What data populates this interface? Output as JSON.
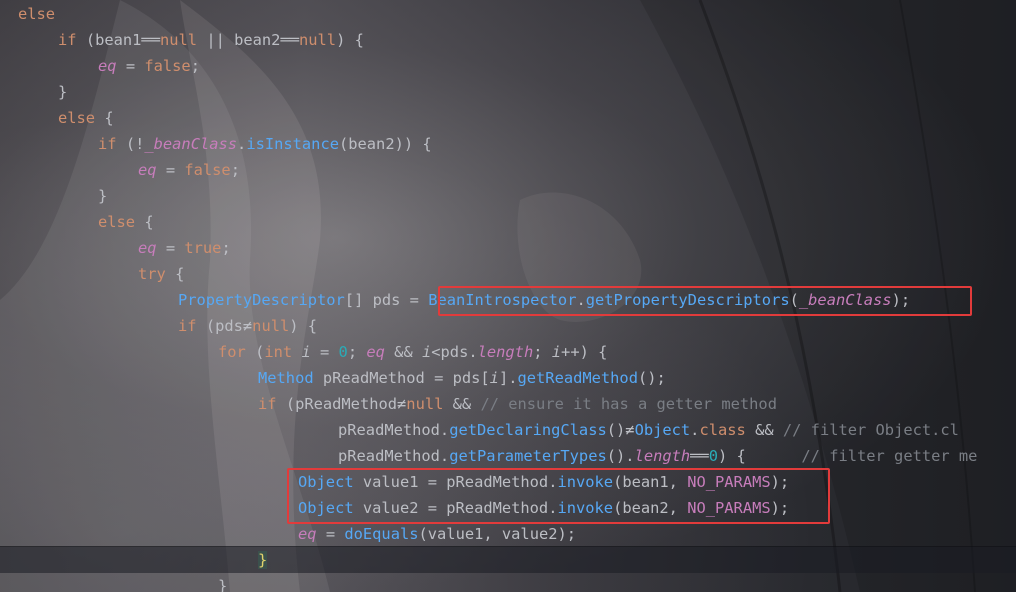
{
  "editor": {
    "language": "java",
    "colors": {
      "keyword": "#cf8e6d",
      "field_italic": "#c77dbb",
      "method": "#56a8f5",
      "number": "#2aacb8",
      "comment": "#7a7e85",
      "text": "#bcbec4",
      "highlight_box": "#e23b3b"
    },
    "lines": [
      {
        "id": "l1",
        "indent": 0,
        "tokens": [
          [
            "kw",
            "else"
          ]
        ]
      },
      {
        "id": "l2",
        "indent": 1,
        "tokens": [
          [
            "kw",
            "if "
          ],
          [
            "",
            "(bean1"
          ],
          [
            "",
            "══"
          ],
          [
            "kw",
            "null"
          ],
          [
            "",
            " || bean2"
          ],
          [
            "",
            "══"
          ],
          [
            "kw",
            "null"
          ],
          [
            "",
            ") {"
          ]
        ]
      },
      {
        "id": "l3",
        "indent": 2,
        "tokens": [
          [
            "fld",
            "eq"
          ],
          [
            "",
            " = "
          ],
          [
            "kw",
            "false"
          ],
          [
            "",
            ";"
          ]
        ]
      },
      {
        "id": "l4",
        "indent": 1,
        "tokens": [
          [
            "",
            "}"
          ]
        ]
      },
      {
        "id": "l5",
        "indent": 1,
        "tokens": [
          [
            "kw",
            "else "
          ],
          [
            "",
            "{"
          ]
        ]
      },
      {
        "id": "l6",
        "indent": 2,
        "tokens": [
          [
            "kw",
            "if "
          ],
          [
            "",
            "(!"
          ],
          [
            "fld",
            "_beanClass"
          ],
          [
            "",
            "."
          ],
          [
            "mth",
            "isInstance"
          ],
          [
            "",
            "(bean2)) {"
          ]
        ]
      },
      {
        "id": "l7",
        "indent": 3,
        "tokens": [
          [
            "fld",
            "eq"
          ],
          [
            "",
            " = "
          ],
          [
            "kw",
            "false"
          ],
          [
            "",
            ";"
          ]
        ]
      },
      {
        "id": "l8",
        "indent": 2,
        "tokens": [
          [
            "",
            "}"
          ]
        ]
      },
      {
        "id": "l9",
        "indent": 2,
        "tokens": [
          [
            "kw",
            "else "
          ],
          [
            "",
            "{"
          ]
        ]
      },
      {
        "id": "l10",
        "indent": 3,
        "tokens": [
          [
            "fld",
            "eq"
          ],
          [
            "",
            " = "
          ],
          [
            "kw",
            "true"
          ],
          [
            "",
            ";"
          ]
        ]
      },
      {
        "id": "l11",
        "indent": 3,
        "tokens": [
          [
            "kw",
            "try "
          ],
          [
            "",
            "{"
          ]
        ]
      },
      {
        "id": "l12",
        "indent": 4,
        "tokens": [
          [
            "cls",
            "PropertyDescriptor"
          ],
          [
            "",
            "[] pds = "
          ],
          [
            "cls",
            "BeanIntrospector"
          ],
          [
            "",
            "."
          ],
          [
            "mth",
            "getPropertyDescriptors"
          ],
          [
            "",
            "("
          ],
          [
            "fld",
            "_beanClass"
          ],
          [
            "",
            ");"
          ]
        ]
      },
      {
        "id": "l13",
        "indent": 4,
        "tokens": [
          [
            "kw",
            "if "
          ],
          [
            "",
            "(pds"
          ],
          [
            "",
            "≠"
          ],
          [
            "kw",
            "null"
          ],
          [
            "",
            ") {"
          ]
        ]
      },
      {
        "id": "l14",
        "indent": 5,
        "tokens": [
          [
            "kw",
            "for "
          ],
          [
            "",
            "("
          ],
          [
            "kw",
            "int "
          ],
          [
            "loc",
            "i"
          ],
          [
            "",
            " = "
          ],
          [
            "num",
            "0"
          ],
          [
            "",
            "; "
          ],
          [
            "fld",
            "eq"
          ],
          [
            "",
            " && "
          ],
          [
            "loc",
            "i"
          ],
          [
            "",
            "<pds."
          ],
          [
            "fld",
            "length"
          ],
          [
            "",
            "; "
          ],
          [
            "loc",
            "i"
          ],
          [
            "",
            "++) {"
          ]
        ]
      },
      {
        "id": "l15",
        "indent": 6,
        "tokens": [
          [
            "cls",
            "Method "
          ],
          [
            "",
            "pReadMethod = pds["
          ],
          [
            "loc",
            "i"
          ],
          [
            "",
            "]."
          ],
          [
            "mth",
            "getReadMethod"
          ],
          [
            "",
            "();"
          ]
        ]
      },
      {
        "id": "l16",
        "indent": 6,
        "tokens": [
          [
            "kw",
            "if "
          ],
          [
            "",
            "(pReadMethod"
          ],
          [
            "",
            "≠"
          ],
          [
            "kw",
            "null"
          ],
          [
            "",
            " && "
          ],
          [
            "cmt",
            "// ensure it has a getter method"
          ]
        ]
      },
      {
        "id": "l17",
        "indent": 8,
        "tokens": [
          [
            "",
            "pReadMethod."
          ],
          [
            "mth",
            "getDeclaringClass"
          ],
          [
            "",
            "()"
          ],
          [
            "",
            "≠"
          ],
          [
            "cls",
            "Object"
          ],
          [
            "",
            "."
          ],
          [
            "kw",
            "class"
          ],
          [
            "",
            " && "
          ],
          [
            "cmt",
            "// filter Object.cl"
          ]
        ]
      },
      {
        "id": "l18",
        "indent": 8,
        "tokens": [
          [
            "",
            "pReadMethod."
          ],
          [
            "mth",
            "getParameterTypes"
          ],
          [
            "",
            "()."
          ],
          [
            "fld",
            "length"
          ],
          [
            "",
            "══"
          ],
          [
            "num",
            "0"
          ],
          [
            "",
            ") {      "
          ],
          [
            "cmt",
            "// filter getter me"
          ]
        ]
      },
      {
        "id": "l19",
        "indent": 7,
        "tokens": [
          [
            "cls",
            "Object "
          ],
          [
            "",
            "value1 = pReadMethod."
          ],
          [
            "mth",
            "invoke"
          ],
          [
            "",
            "(bean1, "
          ],
          [
            "const",
            "NO_PARAMS"
          ],
          [
            "",
            ");"
          ]
        ]
      },
      {
        "id": "l20",
        "indent": 7,
        "tokens": [
          [
            "cls",
            "Object "
          ],
          [
            "",
            "value2 = pReadMethod."
          ],
          [
            "mth",
            "invoke"
          ],
          [
            "",
            "(bean2, "
          ],
          [
            "const",
            "NO_PARAMS"
          ],
          [
            "",
            ");"
          ]
        ]
      },
      {
        "id": "l21",
        "indent": 7,
        "tokens": [
          [
            "fld",
            "eq"
          ],
          [
            "",
            " = "
          ],
          [
            "mth",
            "doEquals"
          ],
          [
            "",
            "(value1, value2);"
          ]
        ]
      },
      {
        "id": "l22",
        "indent": 6,
        "tokens": [
          [
            "brace-match",
            "}"
          ]
        ]
      },
      {
        "id": "l23",
        "indent": 5,
        "tokens": [
          [
            "",
            "}"
          ]
        ]
      }
    ]
  }
}
